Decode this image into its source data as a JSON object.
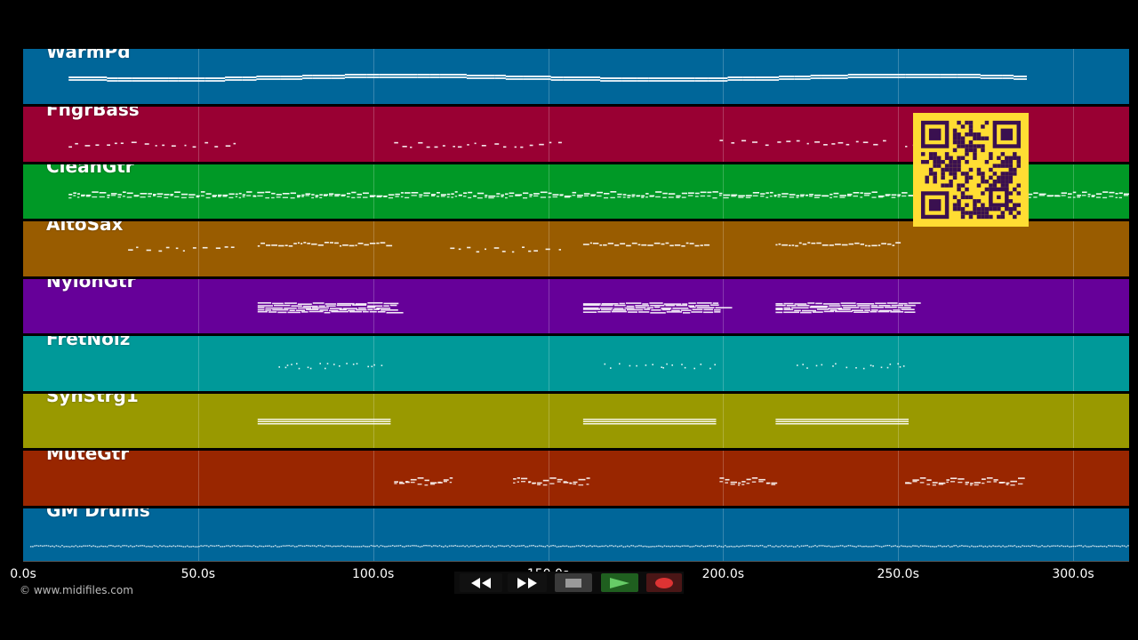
{
  "tracks": [
    {
      "name": "WarmPd",
      "color": "#006699"
    },
    {
      "name": "FngrBass",
      "color": "#990033"
    },
    {
      "name": "CleanGtr",
      "color": "#009926"
    },
    {
      "name": "AltoSax",
      "color": "#995c00"
    },
    {
      "name": "NylonGtr",
      "color": "#660099"
    },
    {
      "name": "FretNoiz",
      "color": "#009999"
    },
    {
      "name": "SynStrg1",
      "color": "#999900"
    },
    {
      "name": "MuteGtr",
      "color": "#992600"
    },
    {
      "name": "GM Drums",
      "color": "#006699"
    }
  ],
  "timeline": {
    "ticks": [
      "0.0s",
      "50.0s",
      "100.0s",
      "150.0s",
      "200.0s",
      "250.0s",
      "300.0s"
    ],
    "tick_values": [
      0,
      50,
      100,
      150,
      200,
      250,
      300
    ],
    "max_seconds": 316
  },
  "copyright": "© www.midifiles.com",
  "transport": {
    "buttons": [
      {
        "name": "rewind-button",
        "icon": "rewind-icon"
      },
      {
        "name": "fast-forward-button",
        "icon": "fast-forward-icon"
      },
      {
        "name": "stop-button",
        "icon": "stop-icon"
      },
      {
        "name": "play-button",
        "icon": "play-icon"
      },
      {
        "name": "record-button",
        "icon": "record-icon"
      }
    ]
  },
  "qr_code": {
    "icon": "qr-code-icon",
    "foreground": "#3a1050",
    "background": "#ffdd33"
  }
}
